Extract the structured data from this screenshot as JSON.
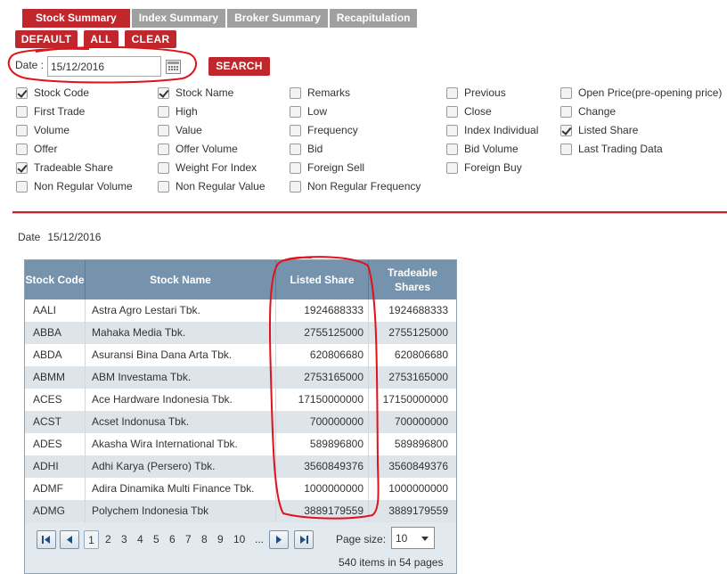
{
  "tabs": [
    "Stock Summary",
    "Index Summary",
    "Broker Summary",
    "Recapitulation"
  ],
  "buttons": {
    "default": "DEFAULT",
    "all": "ALL",
    "clear": "CLEAR",
    "search": "SEARCH"
  },
  "date_filter": {
    "label": "Date :",
    "value": "15/12/2016"
  },
  "checkboxes": [
    {
      "label": "Stock Code",
      "checked": true
    },
    {
      "label": "First Trade",
      "checked": false
    },
    {
      "label": "Volume",
      "checked": false
    },
    {
      "label": "Offer",
      "checked": false
    },
    {
      "label": "Tradeable Share",
      "checked": true
    },
    {
      "label": "Non Regular Volume",
      "checked": false
    },
    {
      "label": "Stock Name",
      "checked": true
    },
    {
      "label": "High",
      "checked": false
    },
    {
      "label": "Value",
      "checked": false
    },
    {
      "label": "Offer Volume",
      "checked": false
    },
    {
      "label": "Weight For Index",
      "checked": false
    },
    {
      "label": "Non Regular Value",
      "checked": false
    },
    {
      "label": "Remarks",
      "checked": false
    },
    {
      "label": "Low",
      "checked": false
    },
    {
      "label": "Frequency",
      "checked": false
    },
    {
      "label": "Bid",
      "checked": false
    },
    {
      "label": "Foreign Sell",
      "checked": false
    },
    {
      "label": "Non Regular Frequency",
      "checked": false
    },
    {
      "label": "Previous",
      "checked": false
    },
    {
      "label": "Close",
      "checked": false
    },
    {
      "label": "Index Individual",
      "checked": false
    },
    {
      "label": "Bid Volume",
      "checked": false
    },
    {
      "label": "Foreign Buy",
      "checked": false
    },
    {
      "label": "Open Price(pre-opening price)",
      "checked": false
    },
    {
      "label": "Change",
      "checked": false
    },
    {
      "label": "Listed Share",
      "checked": true
    },
    {
      "label": "Last Trading Data",
      "checked": false
    }
  ],
  "result_date": {
    "label": "Date",
    "value": "15/12/2016"
  },
  "table": {
    "headers": [
      "Stock Code",
      "Stock Name",
      "Listed Share",
      "Tradeable Shares"
    ],
    "rows": [
      [
        "AALI",
        "Astra Agro Lestari Tbk.",
        "1924688333",
        "1924688333"
      ],
      [
        "ABBA",
        "Mahaka Media Tbk.",
        "2755125000",
        "2755125000"
      ],
      [
        "ABDA",
        "Asuransi Bina Dana Arta Tbk.",
        "620806680",
        "620806680"
      ],
      [
        "ABMM",
        "ABM Investama Tbk.",
        "2753165000",
        "2753165000"
      ],
      [
        "ACES",
        "Ace Hardware Indonesia Tbk.",
        "17150000000",
        "17150000000"
      ],
      [
        "ACST",
        "Acset Indonusa Tbk.",
        "700000000",
        "700000000"
      ],
      [
        "ADES",
        "Akasha Wira International Tbk.",
        "589896800",
        "589896800"
      ],
      [
        "ADHI",
        "Adhi Karya (Persero) Tbk.",
        "3560849376",
        "3560849376"
      ],
      [
        "ADMF",
        "Adira Dinamika Multi Finance Tbk.",
        "1000000000",
        "1000000000"
      ],
      [
        "ADMG",
        "Polychem Indonesia Tbk",
        "3889179559",
        "3889179559"
      ]
    ]
  },
  "pager": {
    "pages": [
      "1",
      "2",
      "3",
      "4",
      "5",
      "6",
      "7",
      "8",
      "9",
      "10",
      "..."
    ],
    "current_page": "1",
    "page_size_label": "Page size:",
    "page_size": "10",
    "items_count": "540",
    "items_text": "items in",
    "pages_count": "54",
    "pages_text": "pages"
  },
  "colors": {
    "accent": "#c0272d",
    "header_blue": "#7693ad",
    "inactive_tab": "#a0a0a0",
    "annotation": "#e0121a"
  }
}
